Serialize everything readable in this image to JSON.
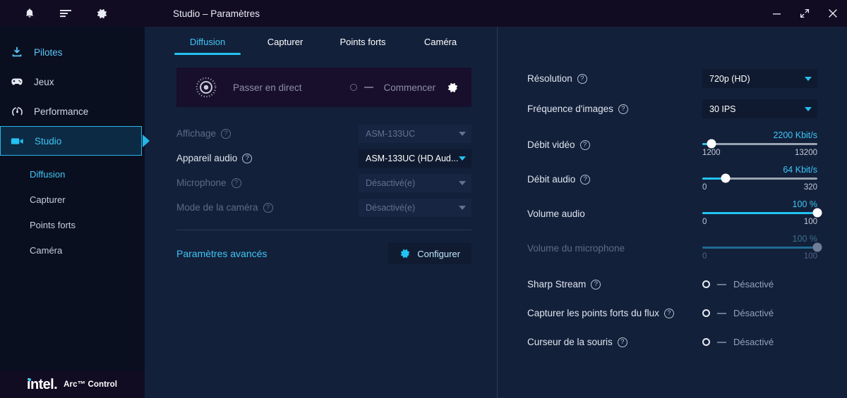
{
  "window": {
    "title": "Studio – Paramètres",
    "controls": [
      {
        "name": "minimize-button",
        "glyph": "—"
      },
      {
        "name": "maximize-button",
        "glyph": "⤢"
      },
      {
        "name": "close-button",
        "glyph": "✕"
      }
    ]
  },
  "sidebar": {
    "header_icons": [
      "bell-icon",
      "list-icon",
      "gear-icon"
    ],
    "items": [
      {
        "label": "Pilotes",
        "icon": "download-icon"
      },
      {
        "label": "Jeux",
        "icon": "gamepad-icon"
      },
      {
        "label": "Performance",
        "icon": "gauge-icon"
      },
      {
        "label": "Studio",
        "icon": "video-camera-icon"
      }
    ],
    "sub_items": [
      {
        "label": "Diffusion"
      },
      {
        "label": "Capturer"
      },
      {
        "label": "Points forts"
      },
      {
        "label": "Caméra"
      }
    ],
    "brand": {
      "logo": "intel",
      "product": "Arc™ Control"
    }
  },
  "tabs": [
    {
      "label": "Diffusion"
    },
    {
      "label": "Capturer"
    },
    {
      "label": "Points forts"
    },
    {
      "label": "Caméra"
    }
  ],
  "golive": {
    "icon": "record-target-icon",
    "label": "Passer en direct",
    "toggle_label": "Commencer",
    "settings_icon": "gear-icon"
  },
  "left_form": {
    "rows": [
      {
        "label": "Affichage",
        "value": "ASM-133UC",
        "disabled": true
      },
      {
        "label": "Appareil audio",
        "value": "ASM-133UC (HD Aud...",
        "disabled": false
      },
      {
        "label": "Microphone",
        "value": "Désactivé(e)",
        "disabled": true
      },
      {
        "label": "Mode de la caméra",
        "value": "Désactivé(e)",
        "disabled": true
      }
    ],
    "advanced_label": "Paramètres avancés",
    "configure_label": "Configurer"
  },
  "right_panel": {
    "resolution": {
      "label": "Résolution",
      "value": "720p (HD)"
    },
    "framerate": {
      "label": "Fréquence d'images",
      "value": "30 IPS"
    },
    "video_bitrate": {
      "label": "Débit vidéo",
      "value": "2200 Kbit/s",
      "min": "1200",
      "max": "13200",
      "percent": 8
    },
    "audio_bitrate": {
      "label": "Débit audio",
      "value": "64 Kbit/s",
      "min": "0",
      "max": "320",
      "percent": 20
    },
    "audio_volume": {
      "label": "Volume audio",
      "value": "100 %",
      "min": "0",
      "max": "100",
      "percent": 100
    },
    "mic_volume": {
      "label": "Volume du microphone",
      "value": "100 %",
      "min": "0",
      "max": "100",
      "percent": 100,
      "disabled": true
    },
    "toggles": [
      {
        "label": "Sharp Stream",
        "state": "Désactivé",
        "has_help": true
      },
      {
        "label": "Capturer les points forts du flux",
        "state": "Désactivé",
        "has_help": true
      },
      {
        "label": "Curseur de la souris",
        "state": "Désactivé",
        "has_help": true
      }
    ]
  },
  "colors": {
    "accent": "#22c3f3",
    "panel": "#13203a",
    "sidebar": "#0a0f20",
    "titlebar": "#120c22"
  }
}
